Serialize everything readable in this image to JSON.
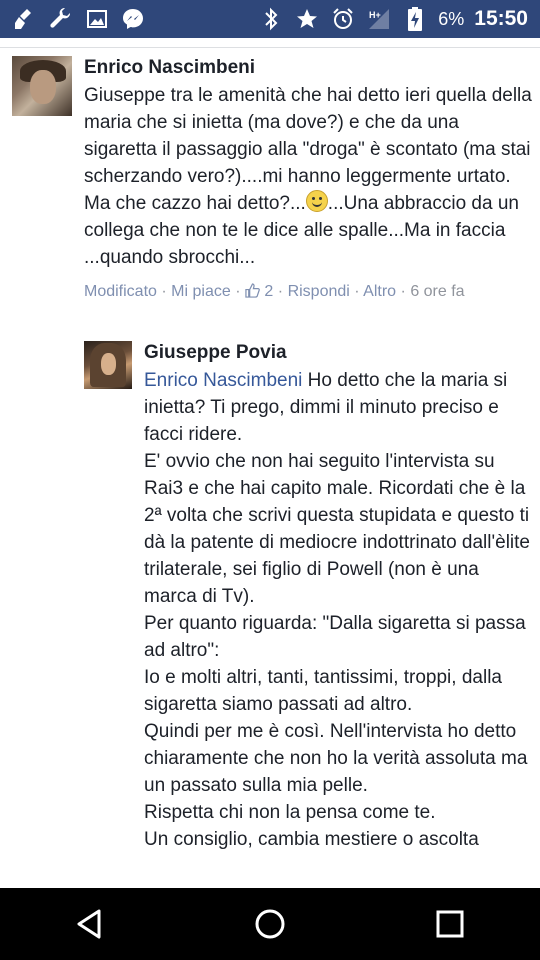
{
  "status_bar": {
    "left_icons": [
      "broom-icon",
      "wrench-icon",
      "image-icon",
      "messenger-icon"
    ],
    "right_icons": [
      "bluetooth-icon",
      "star-icon",
      "alarm-icon",
      "signal-icon",
      "battery-charging-icon"
    ],
    "battery": "6%",
    "time": "15:50",
    "background": "#2f477a"
  },
  "comment": {
    "author": "Enrico Nascimbeni",
    "text_before_emoji": "Giuseppe tra le amenità che hai detto ieri quella della maria che si inietta (ma dove?) e che da una sigaretta il passaggio alla \"droga\" è scontato (ma stai scherzando vero?)....mi hanno leggermente urtato. Ma che cazzo hai detto?...",
    "text_after_emoji": "...Una abbraccio da un collega che non te le dice alle spalle...Ma in faccia ...quando sbrocchi...",
    "meta": {
      "edited": "Modificato",
      "like": "Mi piace",
      "like_count": "2",
      "reply": "Rispondi",
      "more": "Altro",
      "time": "6 ore fa",
      "separator": "·"
    }
  },
  "reply": {
    "author": "Giuseppe Povia",
    "mention": "Enrico Nascimbeni",
    "first_line_rest": " Ho detto che la maria si inietta? Ti prego, dimmi il minuto preciso e facci ridere.",
    "paragraphs": [
      "E' ovvio che non hai seguito l'intervista su Rai3 e che hai capito male. Ricordati che è la 2ª volta che scrivi questa stupidata e questo ti dà la patente di mediocre indottrinato dall'èlite trilaterale, sei figlio di Powell (non è una marca di Tv).",
      "Per quanto riguarda: \"Dalla sigaretta si passa ad altro\":",
      "Io e molti altri, tanti, tantissimi, troppi, dalla sigaretta siamo passati ad altro.",
      "Quindi per me è così. Nell'intervista ho detto chiaramente che non ho la verità assoluta ma un passato sulla mia pelle.",
      "Rispetta chi non la pensa come te.",
      "Un consiglio, cambia mestiere o ascolta"
    ]
  },
  "nav_bar": {
    "buttons": [
      "back-icon",
      "home-icon",
      "recents-icon"
    ]
  }
}
